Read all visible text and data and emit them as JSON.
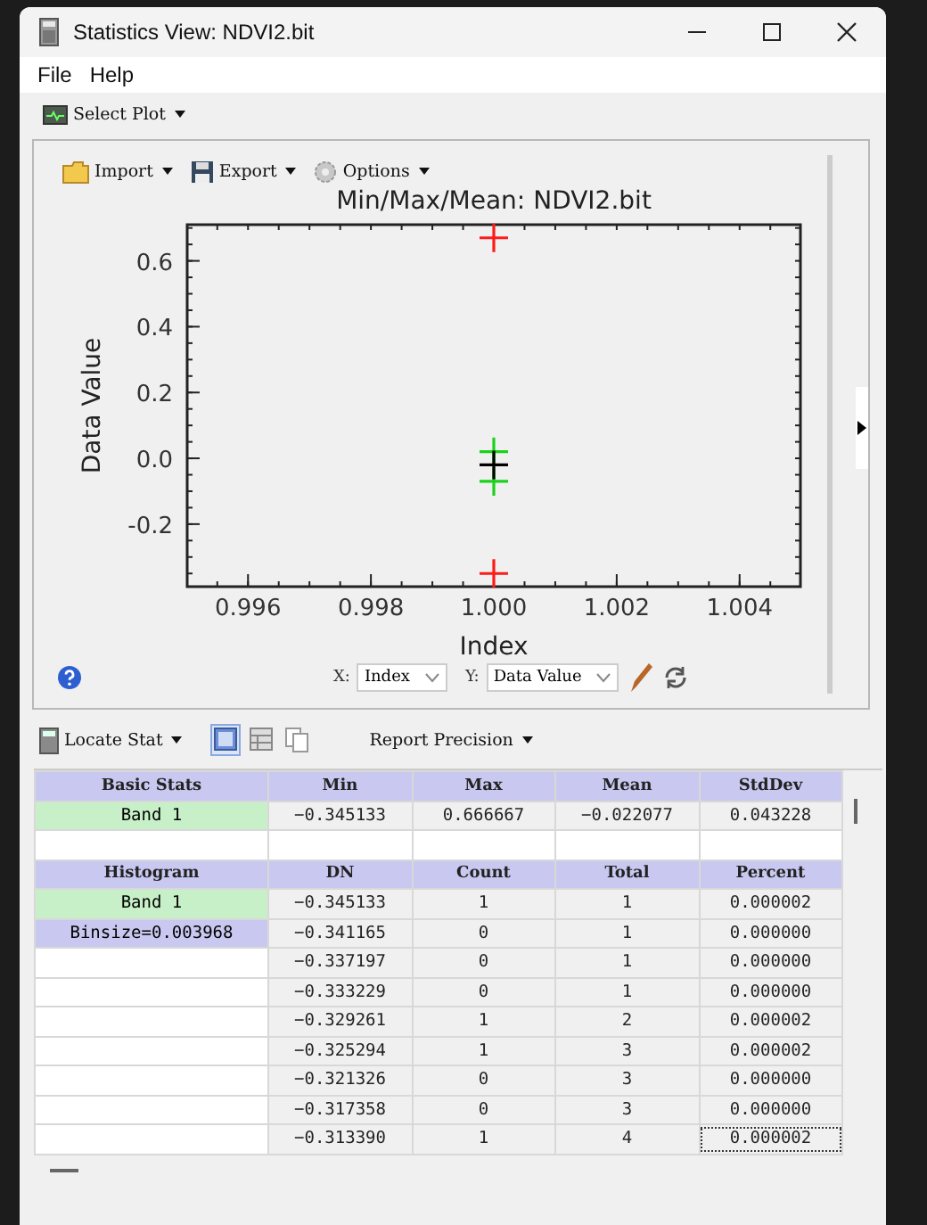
{
  "window": {
    "title": "Statistics View: NDVI2.bit"
  },
  "menu": [
    "File",
    "Help"
  ],
  "select_plot": {
    "label": "Select Plot"
  },
  "plot_toolbar": [
    {
      "kind": "import",
      "label": "Import"
    },
    {
      "kind": "export",
      "label": "Export"
    },
    {
      "kind": "options",
      "label": "Options"
    }
  ],
  "chart_data": {
    "type": "scatter",
    "title": "Min/Max/Mean: NDVI2.bit",
    "xlabel": "Index",
    "ylabel": "Data Value",
    "x": [
      1.0,
      1.0
    ],
    "series": [
      {
        "color": "#ff1a1a",
        "values": [
          -0.35,
          0.67
        ]
      },
      {
        "color": "#1ad21a",
        "values": [
          -0.07,
          0.02
        ]
      },
      {
        "color": "#000000",
        "values": [
          -0.02,
          null
        ]
      }
    ],
    "xlim": [
      0.99501,
      1.00499
    ],
    "ylim": [
      -0.39,
      0.71
    ],
    "xticks": [
      0.996,
      0.998,
      {
        "value": 1.0,
        "label": "1.000"
      },
      1.002,
      1.004
    ],
    "yticks": [
      {
        "value": -0.2,
        "label": "-0.2"
      },
      {
        "value": 0,
        "label": "0.0"
      },
      0.2,
      0.4,
      0.6
    ]
  },
  "axis_controls": [
    {
      "axis": "X:",
      "value": "Index"
    },
    {
      "axis": "Y:",
      "value": "Data Value"
    }
  ],
  "stats_toolbar": {
    "locate": "Locate Stat",
    "views": [
      {
        "kind": "grid",
        "selected": true
      },
      {
        "kind": "table",
        "selected": false
      },
      {
        "kind": "copy",
        "selected": false
      }
    ],
    "precision": "Report Precision"
  },
  "basic_stats": {
    "columns": [
      "Basic Stats",
      "Min",
      "Max",
      "Mean",
      "StdDev"
    ],
    "rows": [
      {
        "kind": "band",
        "cells": [
          "Band 1",
          "−0.345133",
          "0.666667",
          "−0.022077",
          "0.043228"
        ]
      }
    ]
  },
  "histogram": {
    "columns": [
      "Histogram",
      "DN",
      "Count",
      "Total",
      "Percent"
    ],
    "rows": [
      {
        "kind": "band",
        "cells": [
          "Band 1",
          "−0.345133",
          "1",
          "1",
          "0.000002"
        ],
        "focused": false
      },
      {
        "kind": "binsize",
        "cells": [
          "Binsize=0.003968",
          "−0.341165",
          "0",
          "1",
          "0.000000"
        ],
        "focused": false
      },
      {
        "kind": "empty",
        "cells": [
          "",
          "−0.337197",
          "0",
          "1",
          "0.000000"
        ],
        "focused": false
      },
      {
        "kind": "empty",
        "cells": [
          "",
          "−0.333229",
          "0",
          "1",
          "0.000000"
        ],
        "focused": false
      },
      {
        "kind": "empty",
        "cells": [
          "",
          "−0.329261",
          "1",
          "2",
          "0.000002"
        ],
        "focused": false
      },
      {
        "kind": "empty",
        "cells": [
          "",
          "−0.325294",
          "1",
          "3",
          "0.000002"
        ],
        "focused": false
      },
      {
        "kind": "empty",
        "cells": [
          "",
          "−0.321326",
          "0",
          "3",
          "0.000000"
        ],
        "focused": false
      },
      {
        "kind": "empty",
        "cells": [
          "",
          "−0.317358",
          "0",
          "3",
          "0.000000"
        ],
        "focused": false
      },
      {
        "kind": "empty",
        "cells": [
          "",
          "−0.313390",
          "1",
          "4",
          "0.000002"
        ],
        "focused": true
      }
    ]
  }
}
